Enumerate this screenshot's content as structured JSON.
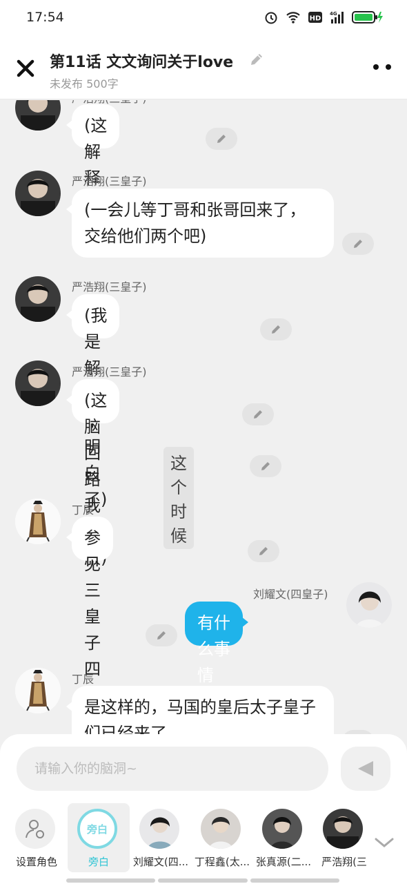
{
  "status_bar": {
    "time": "17:54",
    "icons": [
      "alarm-icon",
      "wifi-icon",
      "hd-icon",
      "4g-signal-icon",
      "battery-charging-icon"
    ]
  },
  "header": {
    "title": "第11话   文文询问关于love",
    "subtitle": "未发布 500字"
  },
  "messages": [
    {
      "speaker": "严浩翔(三皇子)",
      "text": "(这解释不了)",
      "side": "left"
    },
    {
      "speaker": "严浩翔(三皇子)",
      "text": "(一会儿等丁哥和张哥回来了，交给他们两个吧)",
      "side": "left"
    },
    {
      "speaker": "严浩翔(三皇子)",
      "text": "(我是解释不明白了)",
      "side": "left"
    },
    {
      "speaker": "严浩翔(三皇子)",
      "text": "(这脑回路我佩服)",
      "side": "left"
    },
    {
      "speaker": "",
      "text": "这个时候",
      "side": "narration"
    },
    {
      "speaker": "丁辰",
      "text": "参见三皇子四皇子",
      "side": "left"
    },
    {
      "speaker": "刘耀文(四皇子)",
      "text": "有什么事情吗？",
      "side": "right"
    },
    {
      "speaker": "丁辰",
      "text": "是这样的，马国的皇后太子皇子们已经来了",
      "side": "left"
    }
  ],
  "composer": {
    "placeholder": "请输入你的脑洞~"
  },
  "roles": [
    {
      "label": "设置角色",
      "avatar_text": ""
    },
    {
      "label": "旁白",
      "avatar_text": "旁白",
      "active": true
    },
    {
      "label": "刘耀文(四...",
      "avatar_text": ""
    },
    {
      "label": "丁程鑫(太...",
      "avatar_text": ""
    },
    {
      "label": "张真源(二...",
      "avatar_text": ""
    },
    {
      "label": "严浩翔(三",
      "avatar_text": ""
    }
  ],
  "colors": {
    "accent": "#1fb3ea",
    "narration_ring": "#7fd9e3",
    "active_label": "#2ec4d4"
  }
}
